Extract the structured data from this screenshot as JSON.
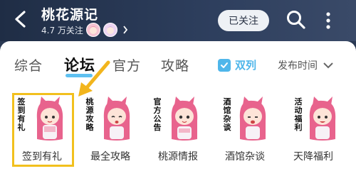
{
  "header": {
    "title": "桃花源记",
    "followers": "4.7 万关注",
    "follow_button": "已关注",
    "icons": [
      "back-arrow-icon",
      "search-icon",
      "more-vertical-icon",
      "chevron-right-icon"
    ]
  },
  "tabs": {
    "items": [
      "综合",
      "论坛",
      "官方",
      "攻略"
    ],
    "active": "论坛"
  },
  "toggle": {
    "label": "双列",
    "checked": true
  },
  "sort": {
    "label": "发布时间"
  },
  "grid": [
    {
      "label": "签到有礼",
      "calligraphy": "签到有礼"
    },
    {
      "label": "最全攻略",
      "calligraphy": "桃源攻略"
    },
    {
      "label": "桃源情报",
      "calligraphy": "官方公告"
    },
    {
      "label": "酒馆杂谈",
      "calligraphy": "酒馆杂谈"
    },
    {
      "label": "天降福利",
      "calligraphy": "活动福利"
    }
  ],
  "colors": {
    "header_bg": "#2b3a54",
    "accent": "#4fb6ea",
    "highlight": "#f2c01d",
    "annotation_arrow": "#f2b51d"
  }
}
